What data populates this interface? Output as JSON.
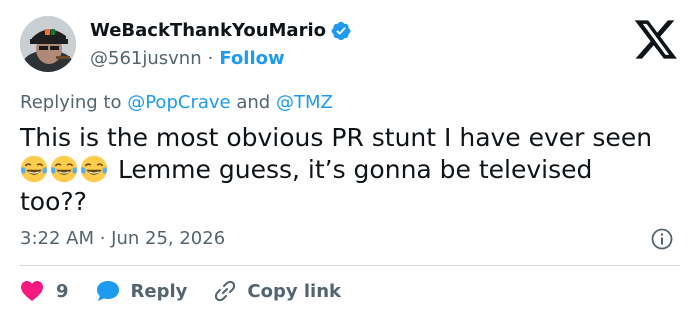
{
  "tweet": {
    "display_name": "WeBackThankYouMario",
    "handle": "@561jusvnn",
    "separator": "·",
    "follow_label": "Follow",
    "replying_prefix": "Replying to",
    "replying_to": [
      "@PopCrave",
      "@TMZ"
    ],
    "replying_joiner": "and",
    "text_line1": "This is the most obvious PR stunt I have ever seen",
    "text_line2": " Lemme guess, it’s gonna be televised",
    "text_line3": "too??",
    "emoji_name": "face-with-tears-of-joy",
    "timestamp": "3:22 AM · Jun 25, 2026"
  },
  "actions": {
    "like_count": "9",
    "reply_label": "Reply",
    "copy_label": "Copy link"
  },
  "colors": {
    "accent": "#1d9bf0",
    "like": "#f91880",
    "muted": "#536471",
    "text": "#0f1419"
  }
}
